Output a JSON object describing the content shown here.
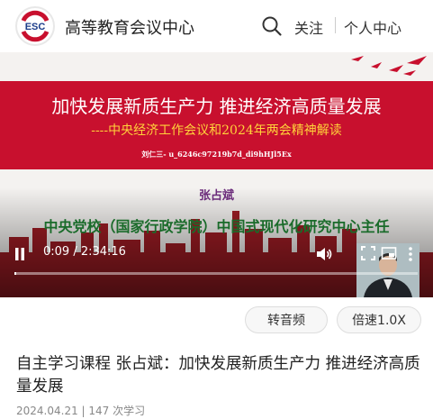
{
  "header": {
    "site_title": "高等教育会议中心",
    "logo_text": "ESC",
    "follow_label": "关注",
    "user_center_label": "个人中心"
  },
  "video": {
    "banner_title": "加快发展新质生产力  推进经济高质量发展",
    "banner_subtitle": "----中央经济工作会议和2024年两会精神解读",
    "watermark": "刘仁三- u_6246c97219b7d_di9hHJl5Ex",
    "speaker_name": "张占斌",
    "speaker_title": "中央党校（国家行政学院）中国式现代化研究中心主任",
    "time_display": "0:09 / 2:34:16",
    "progress_fraction": 0.001
  },
  "actions": {
    "audio_label": "转音频",
    "speed_label": "倍速1.0X"
  },
  "article": {
    "title": "自主学习课程 张占斌：加快发展新质生产力 推进经济高质量发展",
    "meta": "2024.04.21 | 147 次学习"
  },
  "colors": {
    "banner_red": "#c8102e",
    "subtitle_gold": "#ffd23a",
    "speaker_name_purple": "#6a2a7a",
    "speaker_title_green": "#1a6b2a"
  }
}
